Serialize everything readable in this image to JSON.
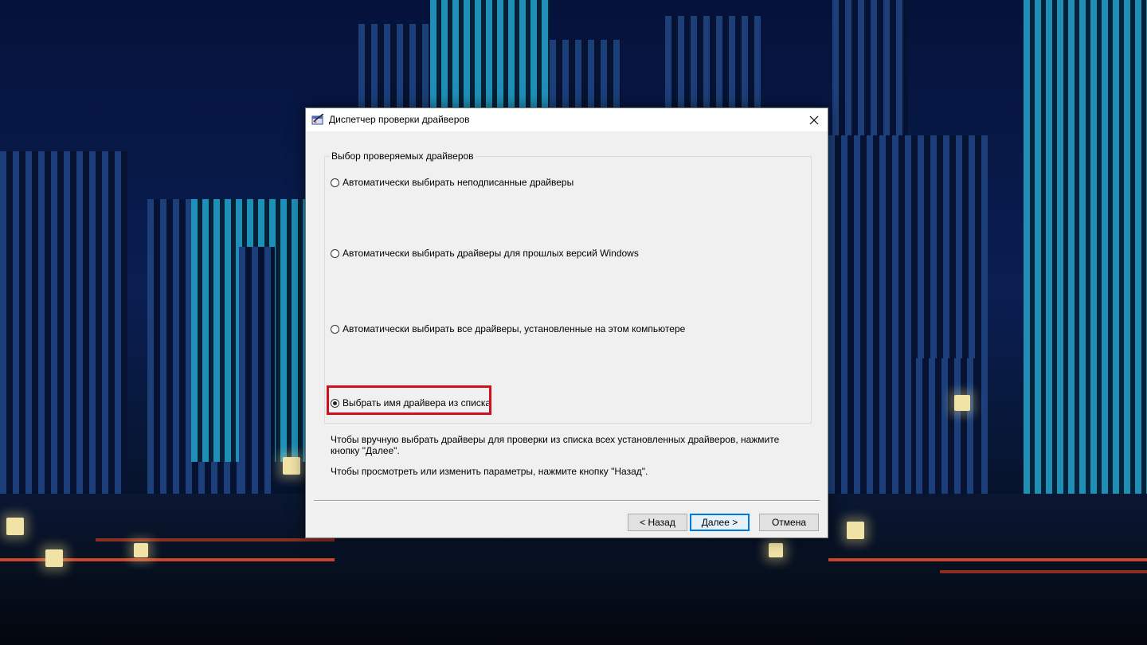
{
  "window": {
    "title": "Диспетчер проверки драйверов",
    "close_glyph": "✕"
  },
  "group": {
    "label": "Выбор проверяемых драйверов",
    "options": [
      {
        "label": "Автоматически выбирать неподписанные драйверы",
        "checked": false
      },
      {
        "label": "Автоматически выбирать драйверы для прошлых версий Windows",
        "checked": false
      },
      {
        "label": "Автоматически выбирать все драйверы, установленные на этом компьютере",
        "checked": false
      },
      {
        "label": "Выбрать имя драйвера из списка",
        "checked": true
      }
    ]
  },
  "description": {
    "line1": "Чтобы вручную выбрать драйверы для проверки из списка всех установленных драйверов, нажмите кнопку \"Далее\".",
    "line2": "Чтобы просмотреть или изменить параметры, нажмите кнопку \"Назад\"."
  },
  "buttons": {
    "back": "< Назад",
    "next": "Далее >",
    "cancel": "Отмена"
  },
  "colors": {
    "highlight": "#d0101a",
    "default_button_border": "#0078d7"
  },
  "icons": {
    "app": "driver-verifier-icon",
    "close": "close-icon"
  }
}
